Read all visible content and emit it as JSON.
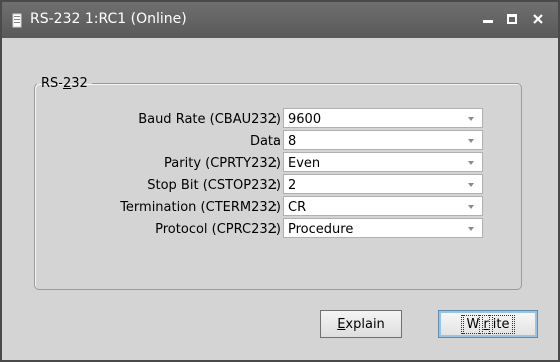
{
  "window": {
    "title": "RS-232 1:RC1 (Online)",
    "controls": {
      "minimize": "minimize-icon",
      "maximize": "maximize-icon",
      "close": "close-icon"
    }
  },
  "group": {
    "legend_prefix": "RS-",
    "legend_mnemonic": "2",
    "legend_suffix": "32"
  },
  "fields": [
    {
      "label": "Baud Rate (CBAU232)",
      "colon": ":",
      "value": "9600"
    },
    {
      "label": "Data",
      "colon": ":",
      "value": "8"
    },
    {
      "label": "Parity (CPRTY232)",
      "colon": ":",
      "value": "Even"
    },
    {
      "label": "Stop Bit (CSTOP232)",
      "colon": ":",
      "value": "2"
    },
    {
      "label": "Termination (CTERM232)",
      "colon": ":",
      "value": "CR"
    },
    {
      "label": "Protocol (CPRC232)",
      "colon": ":",
      "value": "Procedure"
    }
  ],
  "buttons": {
    "explain": {
      "mnemonic": "E",
      "rest": "xplain"
    },
    "write": {
      "first": "W",
      "mnemonic": "r",
      "rest": "ite"
    }
  },
  "colors": {
    "titlebar": "#5e5e5e",
    "client": "#d4d4d4",
    "focus_border": "#5e8bb0"
  }
}
